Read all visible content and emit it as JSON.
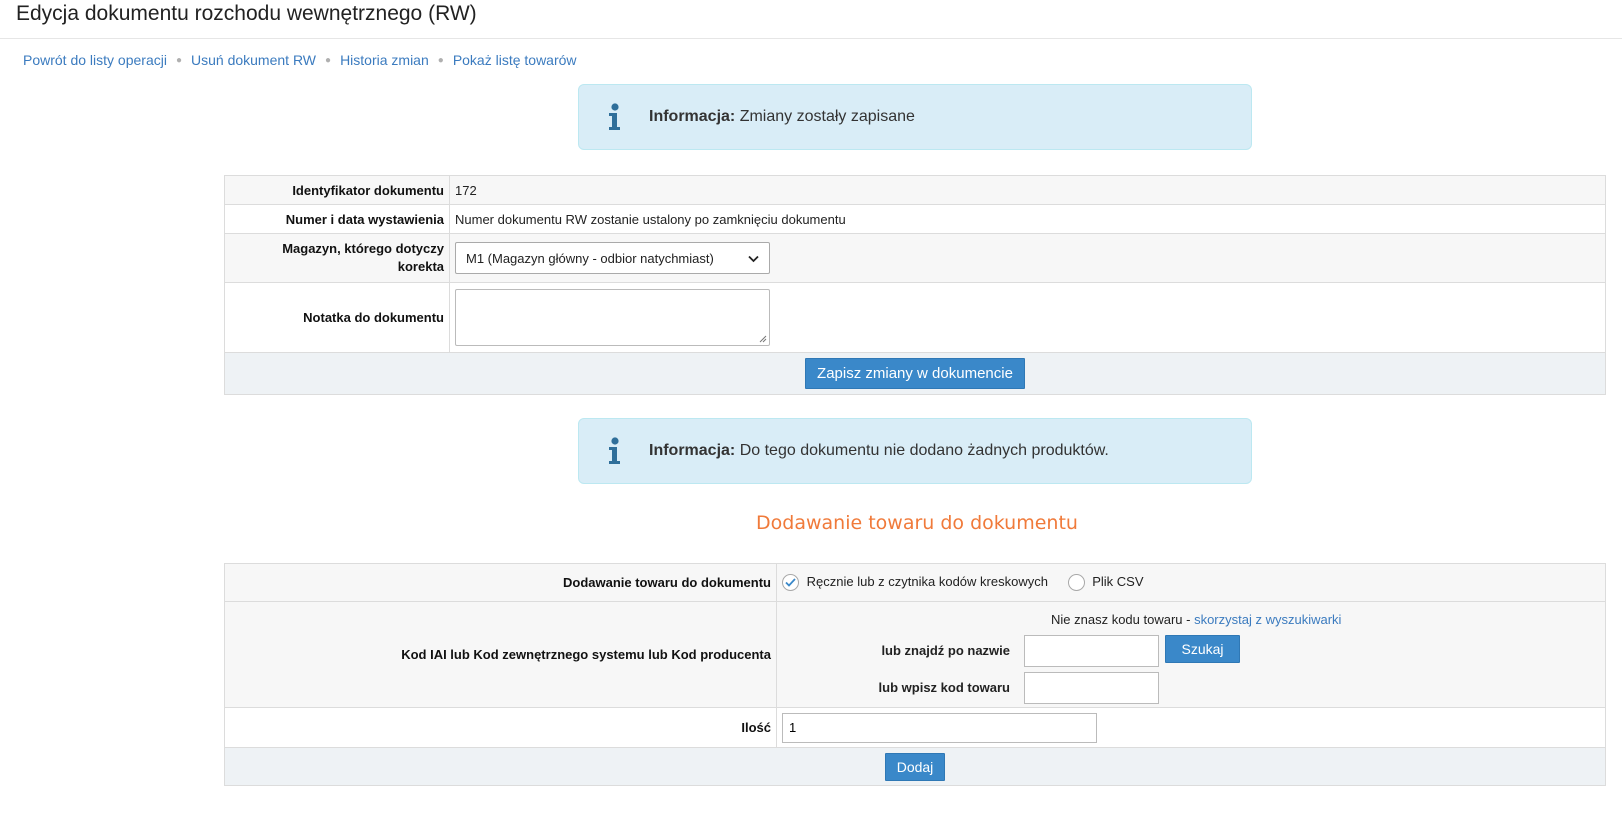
{
  "page": {
    "title": "Edycja dokumentu rozchodu wewnętrznego (RW)"
  },
  "nav": [
    {
      "label": "Powrót do listy operacji"
    },
    {
      "label": "Usuń dokument RW"
    },
    {
      "label": "Historia zmian"
    },
    {
      "label": "Pokaż listę towarów"
    }
  ],
  "info_saved": {
    "prefix": "Informacja:",
    "text": "Zmiany zostały zapisane"
  },
  "document_form": {
    "id_label": "Identyfikator dokumentu",
    "id_value": "172",
    "number_label": "Numer i data wystawienia",
    "number_value": "Numer dokumentu RW zostanie ustalony po zamknięciu dokumentu",
    "warehouse_label_1": "Magazyn, którego dotyczy",
    "warehouse_label_2": "korekta",
    "warehouse_selected": "M1 (Magazyn główny - odbior natychmiast)",
    "note_label": "Notatka do dokumentu",
    "note_value": "",
    "save_button": "Zapisz zmiany w dokumencie"
  },
  "info_no_products": {
    "prefix": "Informacja:",
    "text": "Do tego dokumentu nie dodano żadnych produktów."
  },
  "add_section": {
    "title": "Dodawanie towaru do dokumentu",
    "mode_label": "Dodawanie towaru do dokumentu",
    "mode_manual": "Ręcznie lub z czytnika kodów kreskowych",
    "mode_csv": "Plik CSV",
    "code_label": "Kod IAI lub Kod zewnętrznego systemu lub Kod producenta",
    "search_hint": "Nie znasz kodu towaru - ",
    "search_link": "skorzystaj z wyszukiwarki",
    "by_name_label": "lub znajdź po nazwie",
    "by_name_value": "",
    "search_button": "Szukaj",
    "by_code_label": "lub wpisz kod towaru",
    "by_code_value": "",
    "qty_label": "Ilość",
    "qty_value": "1",
    "add_button": "Dodaj"
  },
  "colors": {
    "link": "#3b7bbf",
    "button": "#3a88c9",
    "info_bg": "#d9edf7",
    "section_title": "#f07a3a"
  }
}
